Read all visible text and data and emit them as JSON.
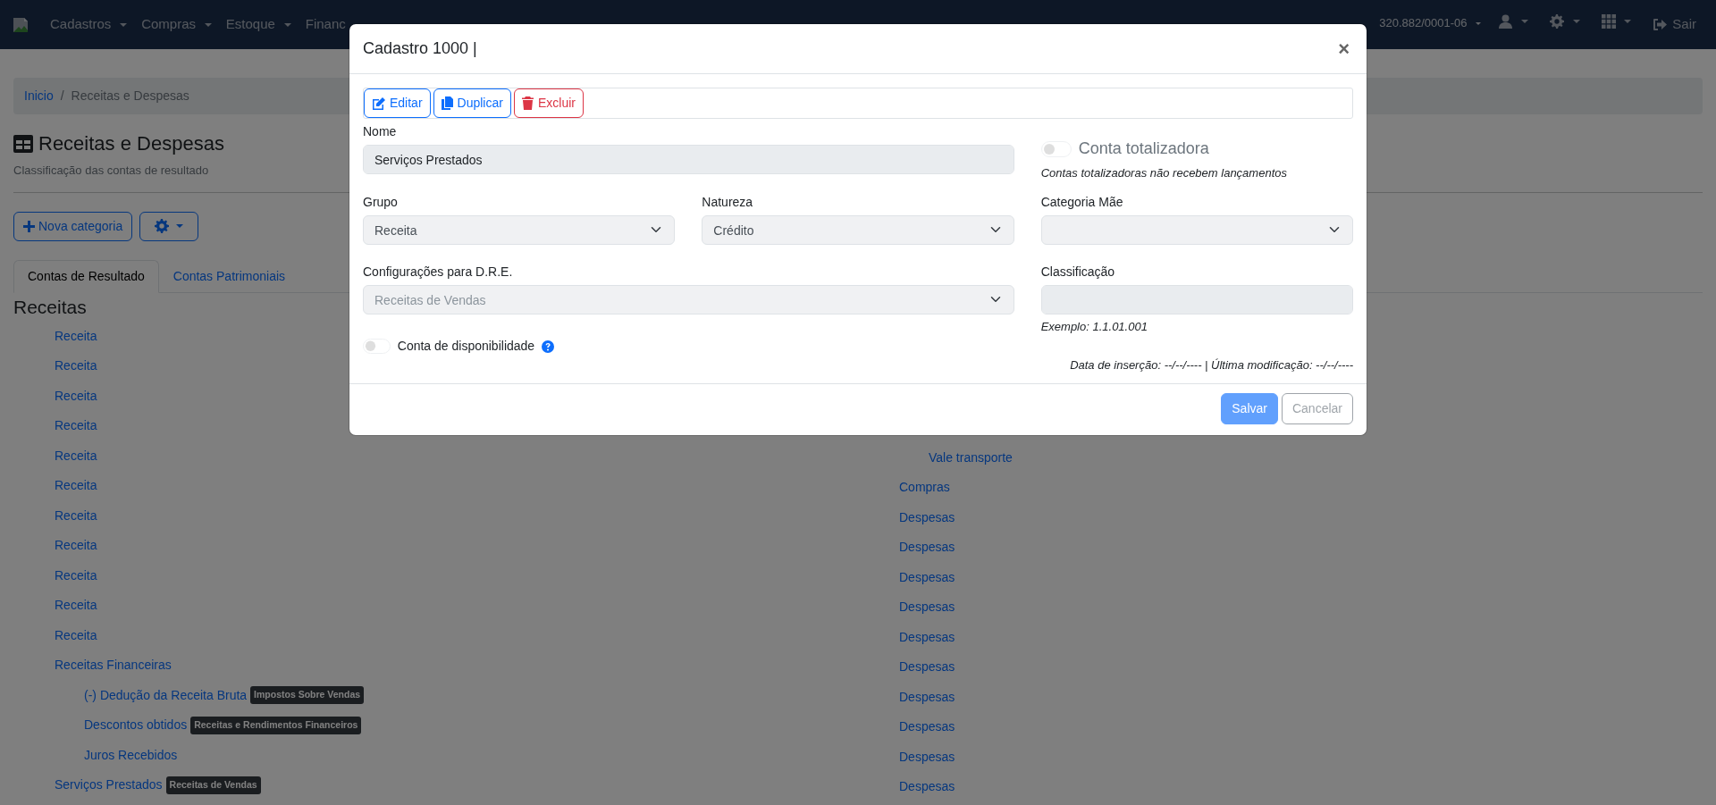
{
  "navbar": {
    "menus": [
      {
        "label": "Cadastros",
        "caret": true
      },
      {
        "label": "Compras",
        "caret": true
      },
      {
        "label": "Estoque",
        "caret": true
      },
      {
        "label": "Financ",
        "caret": false
      }
    ],
    "company": "320.882/0001-06",
    "icon_menus": [
      {
        "kind": "user"
      },
      {
        "kind": "settings"
      },
      {
        "kind": "apps"
      }
    ],
    "logout": "Sair"
  },
  "breadcrumb": {
    "separator": "/",
    "items": [
      {
        "label": "Inicio",
        "link": true
      },
      {
        "label": "Receitas e Despesas",
        "link": false
      }
    ]
  },
  "page": {
    "title": "Receitas e Despesas",
    "subtitle": "Classificação das contas de resultado",
    "new_button": "Nova categoria"
  },
  "tabs": [
    {
      "label": "Contas de Resultado",
      "selected": true
    },
    {
      "label": "Contas Patrimoniais",
      "selected": false
    }
  ],
  "tree": {
    "heading": "Receitas",
    "items": [
      {
        "label": "Receita"
      },
      {
        "label": "Receita"
      },
      {
        "label": "Receita"
      },
      {
        "label": "Receita"
      },
      {
        "label": "Receita"
      },
      {
        "label": "Receita"
      },
      {
        "label": "Receita"
      },
      {
        "label": "Receita"
      },
      {
        "label": "Receita"
      },
      {
        "label": "Receita"
      },
      {
        "label": "Receita"
      },
      {
        "label": "Receitas Financeiras",
        "children": [
          {
            "label": "(-) Dedução da Receita Bruta",
            "badge": "Impostos Sobre Vendas"
          },
          {
            "label": "Descontos obtidos",
            "badge": "Receitas e Rendimentos Financeiros"
          },
          {
            "label": "Juros Recebidos"
          }
        ]
      },
      {
        "label": "Serviços Prestados",
        "badge": "Receitas de Vendas"
      }
    ]
  },
  "right_tree": {
    "items": [
      {
        "children": [
          {
            "label": "Vale transporte"
          }
        ]
      },
      {
        "label": "Compras"
      },
      {
        "label": "Despesas"
      },
      {
        "label": "Despesas"
      },
      {
        "label": "Despesas"
      },
      {
        "label": "Despesas"
      },
      {
        "label": "Despesas"
      },
      {
        "label": "Despesas"
      },
      {
        "label": "Despesas"
      },
      {
        "label": "Despesas"
      },
      {
        "label": "Despesas"
      },
      {
        "label": "Despesas"
      }
    ]
  },
  "modal": {
    "title": "Cadastro 1000 |",
    "close": "×",
    "toolbar": [
      {
        "kind": "edit",
        "label": "Editar"
      },
      {
        "kind": "duplicate",
        "label": "Duplicar"
      },
      {
        "kind": "delete",
        "label": "Excluir"
      }
    ],
    "name": {
      "label": "Nome",
      "value": "Serviços Prestados",
      "disabled": true
    },
    "totalizer": {
      "label": "Conta totalizadora",
      "on": false,
      "disabled": true,
      "hint": "Contas totalizadoras não recebem lançamentos"
    },
    "selects": [
      {
        "label": "Grupo",
        "value": "Receita",
        "disabled": true
      },
      {
        "label": "Natureza",
        "value": "Crédito",
        "disabled": true
      },
      {
        "label": "Categoria Mãe",
        "disabled": true
      }
    ],
    "dre": {
      "label": "Configurações para D.R.E.",
      "placeholder": "Receitas de Vendas",
      "disabled": true
    },
    "classification": {
      "label": "Classificação",
      "disabled": true,
      "hint": "Exemplo: 1.1.01.001"
    },
    "availability": {
      "label": "Conta de disponibilidade",
      "on": false,
      "disabled": true
    },
    "timestamps": "Data de inserção: --/--/---- | Última modificação: --/--/----",
    "footer_buttons": [
      {
        "kind": "primary",
        "label": "Salvar",
        "disabled": true
      },
      {
        "kind": "secondary",
        "label": "Cancelar",
        "disabled": true
      }
    ]
  }
}
